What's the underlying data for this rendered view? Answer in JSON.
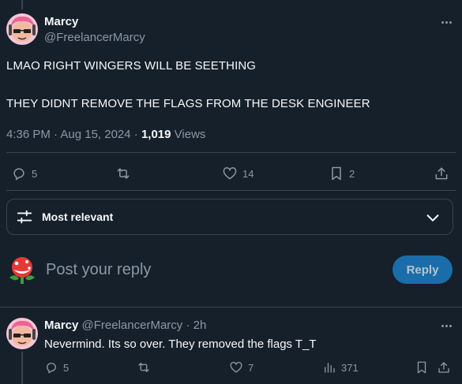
{
  "post": {
    "display_name": "Marcy",
    "handle": "@FreelancerMarcy",
    "text_line1": "LMAO RIGHT WINGERS WILL BE SEETHING",
    "text_line2": "THEY DIDNT REMOVE THE FLAGS FROM THE DESK ENGINEER",
    "time": "4:36 PM · Aug 15, 2024 · ",
    "views_count": "1,019",
    "views_label": " Views",
    "actions": {
      "replies": "5",
      "reposts": "",
      "likes": "14",
      "bookmarks": "2"
    }
  },
  "sort": {
    "label": "Most relevant"
  },
  "reply_box": {
    "placeholder": "Post your reply",
    "button_label": "Reply"
  },
  "reply": {
    "display_name": "Marcy",
    "handle": "@FreelancerMarcy",
    "time": " · 2h",
    "text": "Nevermind. Its so over. They removed the flags T_T",
    "actions": {
      "replies": "5",
      "reposts": "",
      "likes": "7",
      "views": "371"
    }
  },
  "colors": {
    "background": "#15202b",
    "accent": "#1d9bf0",
    "reply_button_bg": "#1a6da8",
    "muted_text": "#8b98a5"
  }
}
